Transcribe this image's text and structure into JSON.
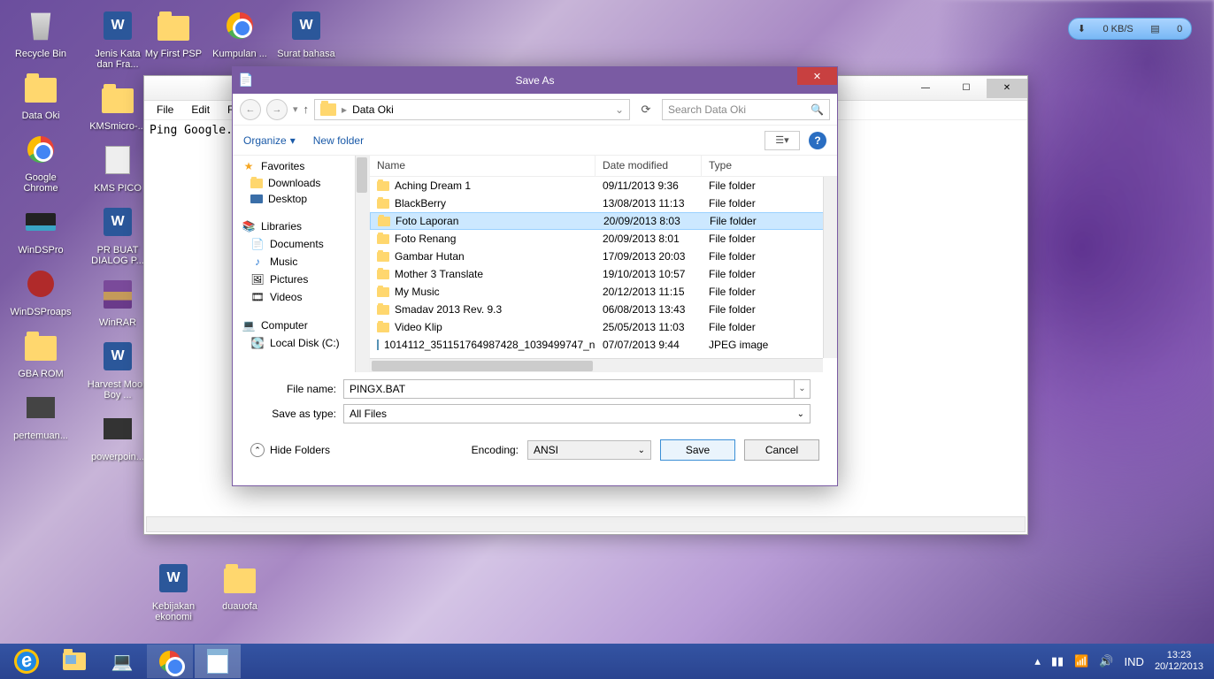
{
  "netspeed": {
    "down": "0 KB/S",
    "disk": "0"
  },
  "desktop": {
    "col1": [
      {
        "id": "recycle",
        "label": "Recycle Bin"
      },
      {
        "id": "dataoki",
        "label": "Data Oki"
      },
      {
        "id": "gchrome",
        "label": "Google Chrome"
      },
      {
        "id": "windspro",
        "label": "WinDSPro"
      },
      {
        "id": "windsproaps",
        "label": "WinDSProaps"
      },
      {
        "id": "gbarom",
        "label": "GBA ROM"
      },
      {
        "id": "pertemuan",
        "label": "pertemuan..."
      }
    ],
    "col2": [
      {
        "id": "jeniskata",
        "label": "Jenis Kata dan Fra..."
      },
      {
        "id": "kmsmicro",
        "label": "KMSmicro-..."
      },
      {
        "id": "kmspico",
        "label": "KMS PICO"
      },
      {
        "id": "prbuat",
        "label": "PR BUAT DIALOG P..."
      },
      {
        "id": "winrar",
        "label": "WinRAR"
      },
      {
        "id": "harvest",
        "label": "Harvest Moon Boy ..."
      },
      {
        "id": "powerpoin",
        "label": "powerpoin..."
      }
    ],
    "col3": [
      {
        "id": "myfirstpsp",
        "label": "My First PSP"
      },
      {
        "id": "kebijakan",
        "label": "Kebijakan ekonomi"
      }
    ],
    "col4": [
      {
        "id": "kumpulan",
        "label": "Kumpulan ..."
      },
      {
        "id": "duaufa",
        "label": "duauofa"
      }
    ],
    "col5": [
      {
        "id": "suratbahasa",
        "label": "Surat bahasa"
      }
    ]
  },
  "notepad": {
    "menus": [
      "File",
      "Edit",
      "Form"
    ],
    "content": "Ping Google."
  },
  "saveas": {
    "title": "Save As",
    "breadcrumb": "Data Oki",
    "search_placeholder": "Search Data Oki",
    "organize": "Organize",
    "newfolder": "New folder",
    "tree": {
      "favorites": "Favorites",
      "fav_items": [
        "Downloads",
        "Desktop"
      ],
      "libraries": "Libraries",
      "lib_items": [
        "Documents",
        "Music",
        "Pictures",
        "Videos"
      ],
      "computer": "Computer",
      "comp_items": [
        "Local Disk (C:)"
      ]
    },
    "columns": {
      "name": "Name",
      "date": "Date modified",
      "type": "Type"
    },
    "files": [
      {
        "name": "Aching Dream 1",
        "date": "09/11/2013 9:36",
        "type": "File folder",
        "kind": "folder"
      },
      {
        "name": "BlackBerry",
        "date": "13/08/2013 11:13",
        "type": "File folder",
        "kind": "folder"
      },
      {
        "name": "Foto Laporan",
        "date": "20/09/2013 8:03",
        "type": "File folder",
        "kind": "folder",
        "selected": true
      },
      {
        "name": "Foto Renang",
        "date": "20/09/2013 8:01",
        "type": "File folder",
        "kind": "folder"
      },
      {
        "name": "Gambar Hutan",
        "date": "17/09/2013 20:03",
        "type": "File folder",
        "kind": "folder"
      },
      {
        "name": "Mother 3 Translate",
        "date": "19/10/2013 10:57",
        "type": "File folder",
        "kind": "folder"
      },
      {
        "name": "My Music",
        "date": "20/12/2013 11:15",
        "type": "File folder",
        "kind": "folder"
      },
      {
        "name": "Smadav 2013 Rev. 9.3",
        "date": "06/08/2013 13:43",
        "type": "File folder",
        "kind": "folder"
      },
      {
        "name": "Video Klip",
        "date": "25/05/2013 11:03",
        "type": "File folder",
        "kind": "folder"
      },
      {
        "name": "1014112_351151764987428_1039499747_n",
        "date": "07/07/2013 9:44",
        "type": "JPEG image",
        "kind": "image"
      }
    ],
    "filename_label": "File name:",
    "filename": "PINGX.BAT",
    "savetype_label": "Save as type:",
    "savetype": "All Files",
    "hide_folders": "Hide Folders",
    "encoding_label": "Encoding:",
    "encoding": "ANSI",
    "save": "Save",
    "cancel": "Cancel"
  },
  "taskbar": {
    "lang": "IND",
    "time": "13:23",
    "date": "20/12/2013"
  }
}
